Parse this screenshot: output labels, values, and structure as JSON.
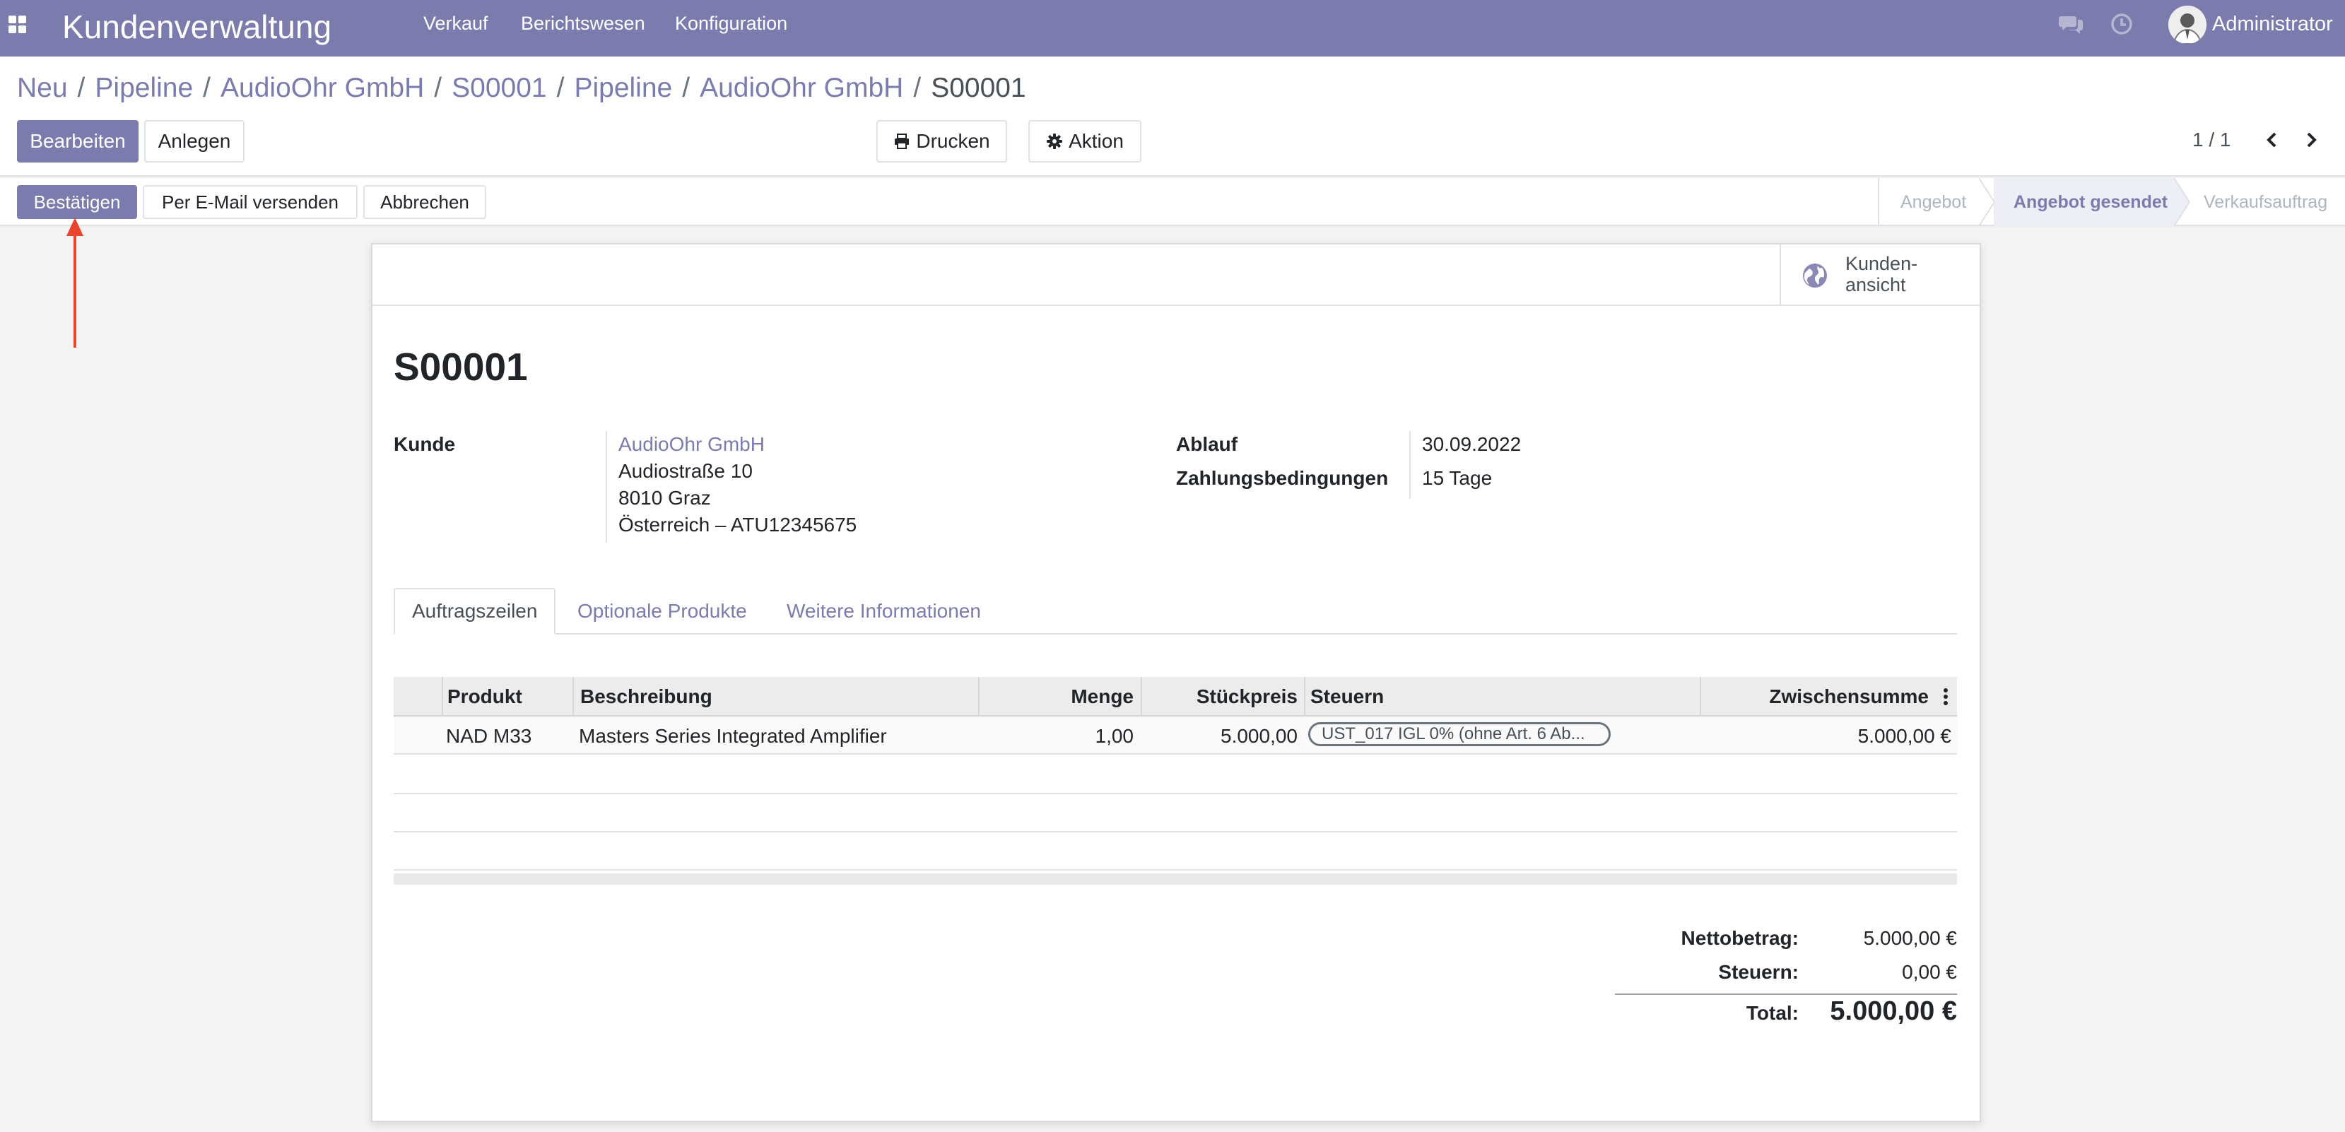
{
  "app": {
    "title": "Kundenverwaltung",
    "menu": [
      "Verkauf",
      "Berichtswesen",
      "Konfiguration"
    ],
    "user": "Administrator",
    "icons": [
      "apps-icon",
      "chat-icon",
      "clock-icon",
      "avatar"
    ]
  },
  "breadcrumb": {
    "items": [
      "Neu",
      "Pipeline",
      "AudioOhr GmbH",
      "S00001",
      "Pipeline",
      "AudioOhr GmbH"
    ],
    "current": "S00001"
  },
  "toolbar": {
    "edit": "Bearbeiten",
    "create": "Anlegen",
    "print": "Drucken",
    "action": "Aktion",
    "pager": "1 / 1"
  },
  "statusbar": {
    "buttons": [
      "Bestätigen",
      "Per E-Mail versenden",
      "Abbrechen"
    ],
    "stages": [
      "Angebot",
      "Angebot gesendet",
      "Verkaufsauftrag"
    ],
    "current_stage": "Angebot gesendet"
  },
  "form": {
    "smart_button": {
      "line1": "Kunden-",
      "line2": "ansicht"
    },
    "title": "S00001",
    "customer_label": "Kunde",
    "customer": {
      "name": "AudioOhr GmbH",
      "street": "Audiostraße 10",
      "city": "8010 Graz",
      "country_vat": "Österreich – ATU12345675"
    },
    "expiry_label": "Ablauf",
    "expiry": "30.09.2022",
    "payment_terms_label": "Zahlungsbedingungen",
    "payment_terms": "15 Tage",
    "tabs": [
      "Auftragszeilen",
      "Optionale Produkte",
      "Weitere Informationen"
    ],
    "active_tab": "Auftragszeilen"
  },
  "order_lines": {
    "columns": [
      "Produkt",
      "Beschreibung",
      "Menge",
      "Stückpreis",
      "Steuern",
      "Zwischensumme"
    ],
    "rows": [
      {
        "product": "NAD M33",
        "description": "Masters Series Integrated Amplifier",
        "quantity": "1,00",
        "unit_price": "5.000,00",
        "taxes": "UST_017 IGL 0% (ohne Art. 6 Ab...",
        "subtotal": "5.000,00 €"
      }
    ]
  },
  "totals": {
    "net_label": "Nettobetrag:",
    "net": "5.000,00 €",
    "tax_label": "Steuern:",
    "tax": "0,00 €",
    "total_label": "Total:",
    "total": "5.000,00 €"
  },
  "colors": {
    "brand": "#7c7bad",
    "annotation_arrow": "#e8452c"
  }
}
